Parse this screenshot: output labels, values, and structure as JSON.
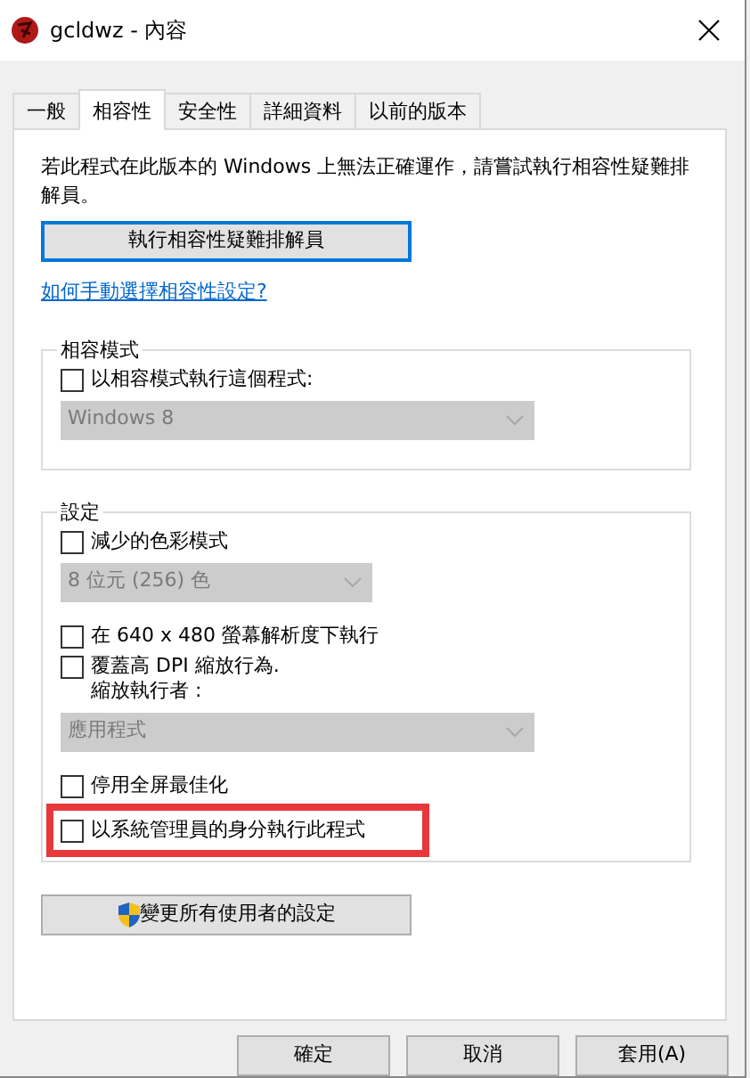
{
  "window": {
    "title": "gcldwz - 內容"
  },
  "tabs": [
    {
      "label": "一般",
      "selected": false
    },
    {
      "label": "相容性",
      "selected": true
    },
    {
      "label": "安全性",
      "selected": false
    },
    {
      "label": "詳細資料",
      "selected": false
    },
    {
      "label": "以前的版本",
      "selected": false
    }
  ],
  "intro": "若此程式在此版本的 Windows 上無法正確運作，請嘗試執行相容性疑難排解員。",
  "troubleshoot_button": "執行相容性疑難排解員",
  "help_link": "如何手動選擇相容性設定?",
  "groups": [
    {
      "title": "相容模式",
      "items": [
        {
          "kind": "checkbox",
          "label": "以相容模式執行這個程式:",
          "checked": false,
          "highlighted": false
        },
        {
          "kind": "dropdown",
          "value": "Windows 8",
          "disabled": true,
          "wide": true
        }
      ]
    },
    {
      "title": "設定",
      "items": [
        {
          "kind": "checkbox",
          "label": "減少的色彩模式",
          "checked": false,
          "highlighted": false
        },
        {
          "kind": "dropdown",
          "value": "8 位元 (256) 色",
          "disabled": true,
          "wide": false
        },
        {
          "kind": "checkbox",
          "label": "在 640 x 480 螢幕解析度下執行",
          "checked": false,
          "highlighted": false
        },
        {
          "kind": "checkbox",
          "label": "覆蓋高 DPI 縮放行為.\n縮放執行者 :",
          "checked": false,
          "highlighted": false
        },
        {
          "kind": "dropdown",
          "value": "應用程式",
          "disabled": true,
          "wide": true
        },
        {
          "kind": "checkbox",
          "label": "停用全屏最佳化",
          "checked": false,
          "highlighted": false
        },
        {
          "kind": "checkbox",
          "label": "以系統管理員的身分執行此程式",
          "checked": false,
          "highlighted": true
        }
      ]
    }
  ],
  "all_users_button": "變更所有使用者的設定",
  "footer_buttons": [
    "確定",
    "取消",
    "套用(A)"
  ]
}
